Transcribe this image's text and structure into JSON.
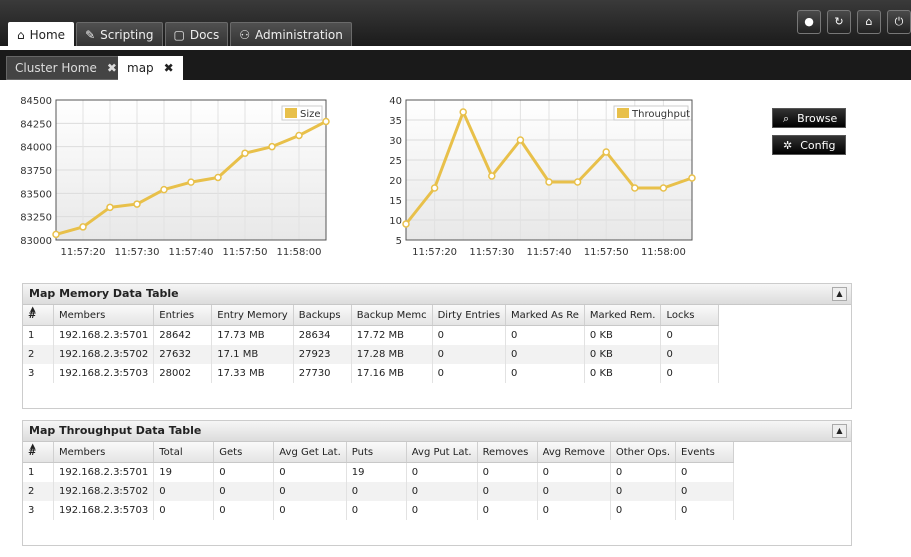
{
  "nav": {
    "tabs": [
      {
        "label": "Home",
        "icon": "home-icon",
        "glyph": "⌂"
      },
      {
        "label": "Scripting",
        "icon": "pencil-icon",
        "glyph": "✎"
      },
      {
        "label": "Docs",
        "icon": "document-icon",
        "glyph": "▢"
      },
      {
        "label": "Administration",
        "icon": "user-icon",
        "glyph": "⚇"
      }
    ],
    "window_buttons": [
      {
        "name": "alarm-icon",
        "glyph": "●"
      },
      {
        "name": "refresh-icon",
        "glyph": "↻"
      },
      {
        "name": "home-icon",
        "glyph": "⌂"
      },
      {
        "name": "power-icon",
        "glyph": "⏻"
      }
    ]
  },
  "subtabs": [
    {
      "label": "Cluster Home",
      "close": "✖"
    },
    {
      "label": "map",
      "close": "✖"
    }
  ],
  "buttons": {
    "browse": {
      "label": "Browse",
      "glyph": "⌕"
    },
    "config": {
      "label": "Config",
      "glyph": "✲"
    }
  },
  "chart_data": [
    {
      "type": "line",
      "legend": "Size",
      "legend_position": "top-right",
      "x_ticks": [
        "11:57:20",
        "11:57:30",
        "11:57:40",
        "11:57:50",
        "11:58:00"
      ],
      "y_ticks": [
        "83000",
        "83250",
        "83500",
        "83750",
        "84000",
        "84250",
        "84500"
      ],
      "ylim": [
        83000,
        84500
      ],
      "grid": true,
      "color": "#e8c04a",
      "values": [
        83060,
        83140,
        83350,
        83385,
        83540,
        83620,
        83670,
        83930,
        84000,
        84120,
        84270
      ]
    },
    {
      "type": "line",
      "legend": "Throughput",
      "legend_position": "top-right",
      "x_ticks": [
        "11:57:20",
        "11:57:30",
        "11:57:40",
        "11:57:50",
        "11:58:00"
      ],
      "y_ticks": [
        "5",
        "10",
        "15",
        "20",
        "25",
        "30",
        "35",
        "40"
      ],
      "ylim": [
        5,
        40
      ],
      "grid": true,
      "color": "#e8c04a",
      "values": [
        9,
        18,
        37,
        21,
        30,
        19.5,
        19.5,
        27,
        18,
        18,
        20.5
      ]
    }
  ],
  "memory_table": {
    "title": "Map Memory Data Table",
    "columns": [
      "#",
      "Members",
      "Entries",
      "Entry Memory",
      "Backups",
      "Backup Memc",
      "Dirty Entries",
      "Marked As Re",
      "Marked Rem.",
      "Locks"
    ],
    "rows": [
      [
        "1",
        "192.168.2.3:5701",
        "28642",
        "17.73 MB",
        "28634",
        "17.72 MB",
        "0",
        "0",
        "0 KB",
        "0"
      ],
      [
        "2",
        "192.168.2.3:5702",
        "27632",
        "17.1 MB",
        "27923",
        "17.28 MB",
        "0",
        "0",
        "0 KB",
        "0"
      ],
      [
        "3",
        "192.168.2.3:5703",
        "28002",
        "17.33 MB",
        "27730",
        "17.16 MB",
        "0",
        "0",
        "0 KB",
        "0"
      ]
    ]
  },
  "throughput_table": {
    "title": "Map Throughput Data Table",
    "columns": [
      "#",
      "Members",
      "Total",
      "Gets",
      "Avg Get Lat.",
      "Puts",
      "Avg Put Lat.",
      "Removes",
      "Avg Remove",
      "Other Ops.",
      "Events"
    ],
    "rows": [
      [
        "1",
        "192.168.2.3:5701",
        "19",
        "0",
        "0",
        "19",
        "0",
        "0",
        "0",
        "0",
        "0"
      ],
      [
        "2",
        "192.168.2.3:5702",
        "0",
        "0",
        "0",
        "0",
        "0",
        "0",
        "0",
        "0",
        "0"
      ],
      [
        "3",
        "192.168.2.3:5703",
        "0",
        "0",
        "0",
        "0",
        "0",
        "0",
        "0",
        "0",
        "0"
      ]
    ]
  }
}
